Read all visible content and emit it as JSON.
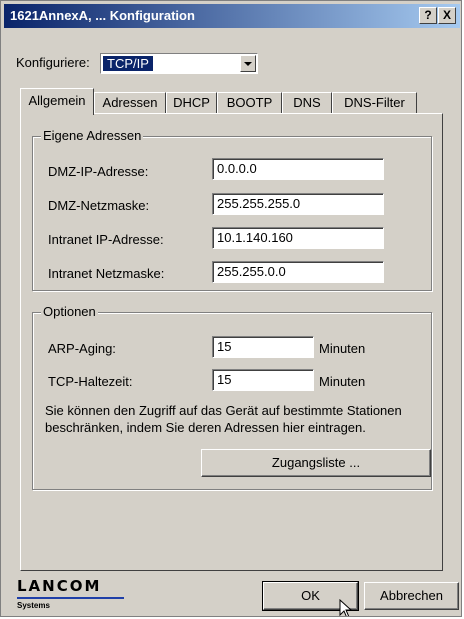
{
  "window": {
    "title": "1621AnnexA, ... Konfiguration",
    "help_label": "?",
    "close_label": "X"
  },
  "configure": {
    "label": "Konfiguriere:",
    "selected": "TCP/IP"
  },
  "tabs": [
    {
      "label": "Allgemein",
      "active": true
    },
    {
      "label": "Adressen"
    },
    {
      "label": "DHCP"
    },
    {
      "label": "BOOTP"
    },
    {
      "label": "DNS"
    },
    {
      "label": "DNS-Filter"
    }
  ],
  "own_addresses": {
    "title": "Eigene Adressen",
    "fields": [
      {
        "label": "DMZ-IP-Adresse:",
        "value": "0.0.0.0"
      },
      {
        "label": "DMZ-Netzmaske:",
        "value": "255.255.255.0"
      },
      {
        "label": "Intranet IP-Adresse:",
        "value": "10.1.140.160"
      },
      {
        "label": "Intranet Netzmaske:",
        "value": "255.255.0.0"
      }
    ]
  },
  "options": {
    "title": "Optionen",
    "arp_label": "ARP-Aging:",
    "arp_value": "15",
    "arp_unit": "Minuten",
    "tcp_label": "TCP-Haltezeit:",
    "tcp_value": "15",
    "tcp_unit": "Minuten",
    "description_line1": "Sie können den Zugriff auf das Gerät auf bestimmte Stationen",
    "description_line2": "beschränken, indem Sie deren Adressen hier eintragen.",
    "access_list_label": "Zugangsliste ..."
  },
  "footer": {
    "logo_name": "LANCOM",
    "logo_sub": "Systems",
    "ok_label": "OK",
    "cancel_label": "Abbrechen"
  },
  "colors": {
    "title_start": "#0a246a",
    "title_end": "#a6caf0",
    "face": "#d4d0c8",
    "selection": "#0a246a",
    "logo_line": "#1f3fa8"
  }
}
